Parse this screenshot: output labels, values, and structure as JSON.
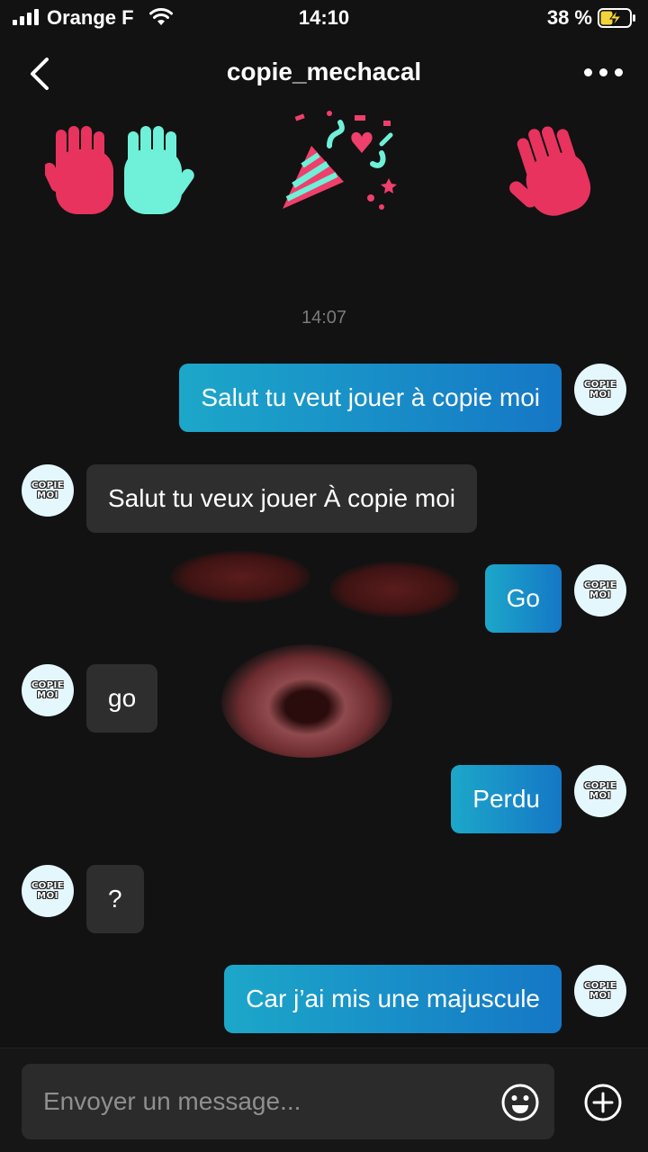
{
  "status_bar": {
    "carrier": "Orange F",
    "time": "14:10",
    "battery": "38 %"
  },
  "header": {
    "title": "copie_mechacal"
  },
  "timestamp": "14:07",
  "avatar": {
    "line1": "COPIE",
    "line2": "MOI"
  },
  "messages": [
    {
      "side": "sent",
      "text": "Salut tu veut jouer à copie moi"
    },
    {
      "side": "received",
      "text": "Salut tu veux jouer À copie moi"
    },
    {
      "side": "sent",
      "text": "Go"
    },
    {
      "side": "received",
      "text": "go"
    },
    {
      "side": "sent",
      "text": "Perdu"
    },
    {
      "side": "received",
      "text": "?"
    },
    {
      "side": "sent",
      "text": "Car j’ai mis une majuscule"
    }
  ],
  "composer": {
    "placeholder": "Envoyer un message..."
  },
  "colors": {
    "background": "#121212",
    "sent_bubble_start": "#1ca7c9",
    "sent_bubble_end": "#1577c6",
    "received_bubble": "#2e2e2e",
    "hand_pink": "#e8335f",
    "hand_cyan": "#6ff0d9"
  },
  "stickers": [
    "clapping-hands-sticker",
    "party-popper-sticker",
    "waving-hand-sticker"
  ]
}
